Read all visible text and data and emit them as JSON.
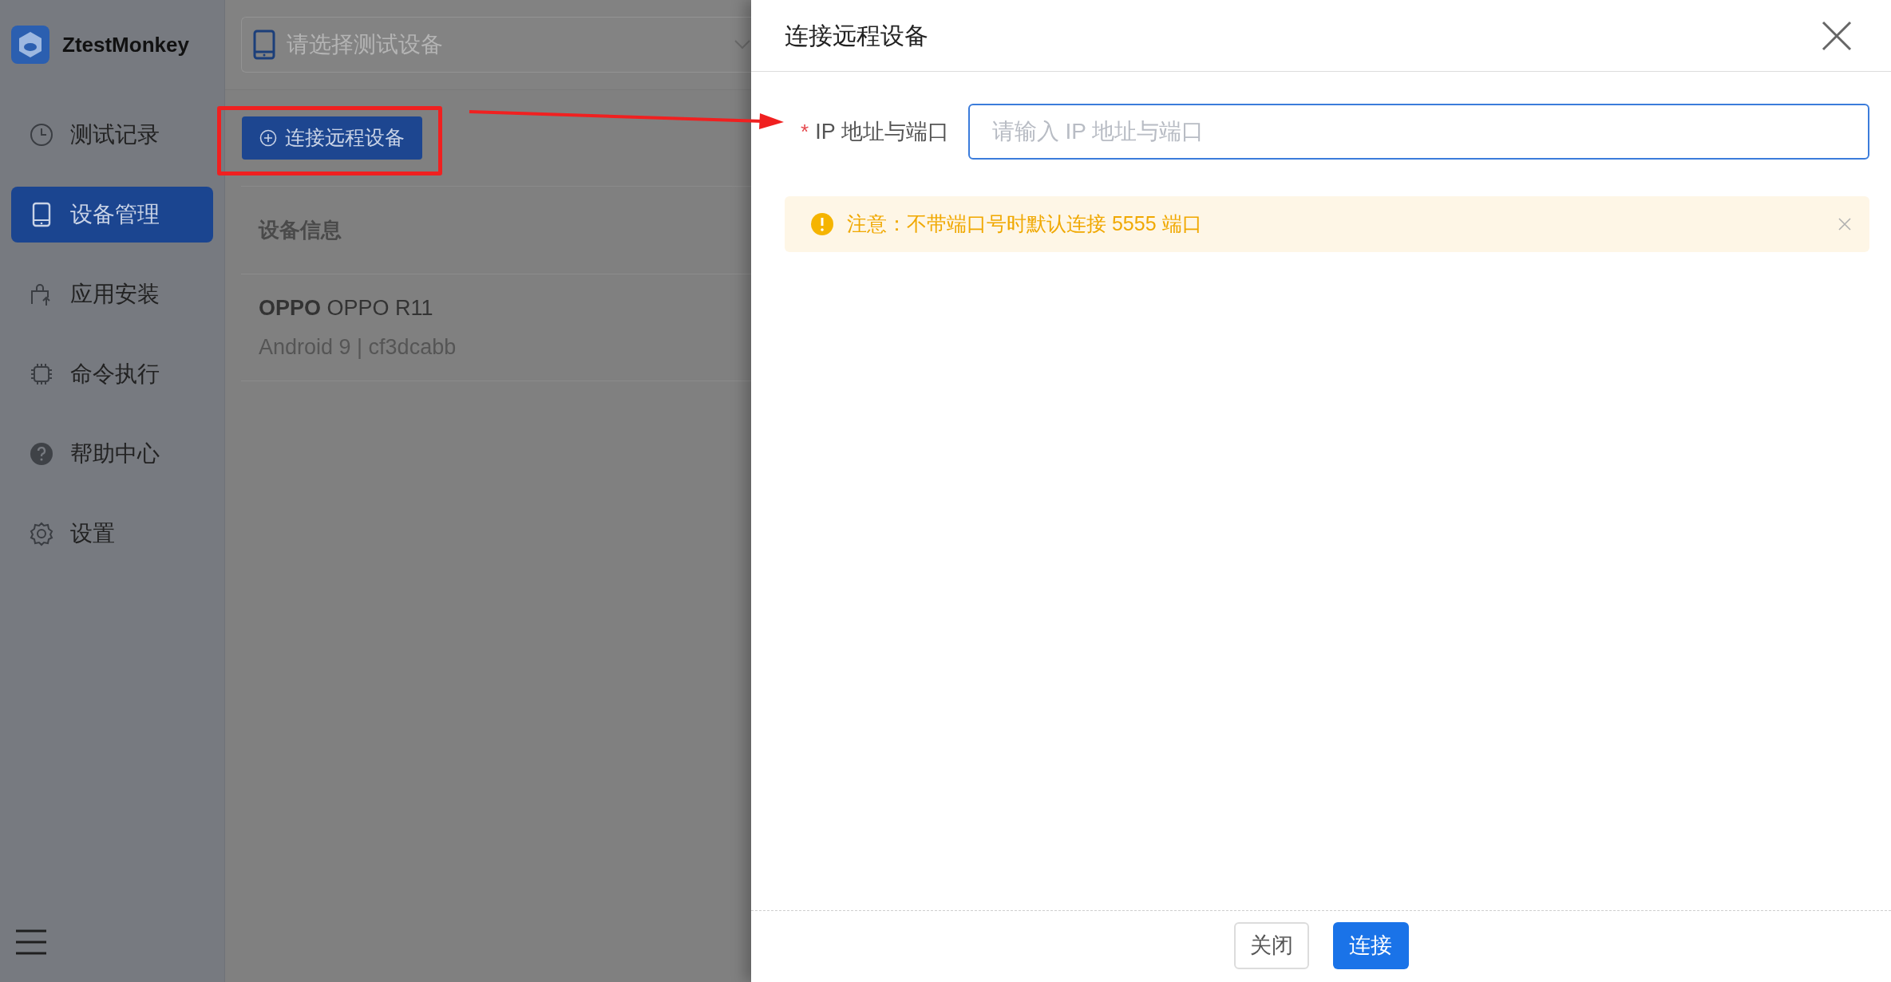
{
  "app": {
    "title": "ZtestMonkey"
  },
  "sidebar": {
    "items": [
      {
        "label": "测试记录",
        "kind": "clock",
        "selected": false
      },
      {
        "label": "设备管理",
        "kind": "tablet",
        "selected": true
      },
      {
        "label": "应用安装",
        "kind": "bag",
        "selected": false
      },
      {
        "label": "命令执行",
        "kind": "chip",
        "selected": false
      },
      {
        "label": "帮助中心",
        "kind": "help",
        "selected": false
      },
      {
        "label": "设置",
        "kind": "gear",
        "selected": false
      }
    ]
  },
  "device_select": {
    "placeholder": "请选择测试设备"
  },
  "connect_button": "连接远程设备",
  "device_table": {
    "header": "设备信息",
    "rows": [
      {
        "brand": "OPPO",
        "model": "OPPO R11",
        "detail": "Android 9 | cf3dcabb"
      }
    ]
  },
  "dialog": {
    "title": "连接远程设备",
    "field": {
      "required_mark": "*",
      "label": "IP 地址与端口",
      "placeholder": "请输入 IP 地址与端口"
    },
    "alert": "注意：不带端口号时默认连接 5555 端口",
    "buttons": [
      {
        "label": "关闭",
        "kind": "default"
      },
      {
        "label": "连接",
        "kind": "primary"
      }
    ]
  }
}
